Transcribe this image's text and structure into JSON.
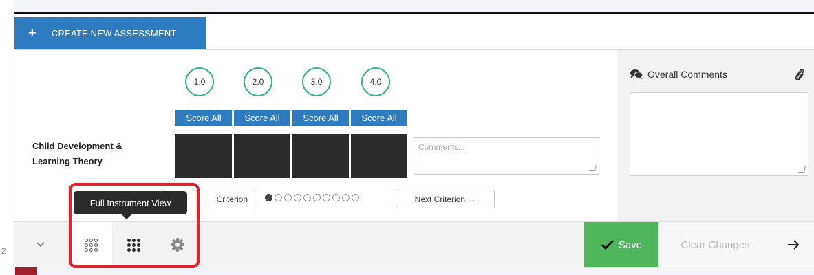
{
  "header": {
    "create_label": "CREATE NEW ASSESSMENT"
  },
  "scores": [
    {
      "level": "1.0",
      "score_all": "Score All"
    },
    {
      "level": "2.0",
      "score_all": "Score All"
    },
    {
      "level": "3.0",
      "score_all": "Score All"
    },
    {
      "level": "4.0",
      "score_all": "Score All"
    }
  ],
  "criterion": {
    "label_line1": "Child Development &",
    "label_line2": "Learning Theory",
    "comments_placeholder": "Comments..."
  },
  "nav": {
    "prev_label": "Criterion",
    "next_label": "Next Criterion →",
    "pager_total": 10,
    "pager_active": 1
  },
  "tooltip": {
    "text": "Full Instrument View"
  },
  "overall_comments": {
    "title": "Overall Comments"
  },
  "footer": {
    "save_label": "Save",
    "clear_label": "Clear Changes"
  },
  "left_edge": {
    "text": "2"
  },
  "colors": {
    "primary_blue": "#2e7bbf",
    "score_ring_green": "#2fb38c",
    "save_green": "#4fb55b",
    "highlight_red": "#e0212e"
  },
  "icons": [
    "plus-icon",
    "comments-icon",
    "paperclip-icon",
    "chevron-down-icon",
    "grid-outline-icon",
    "grid-filled-icon",
    "gear-icon",
    "checkmark-icon",
    "arrow-right-icon"
  ]
}
